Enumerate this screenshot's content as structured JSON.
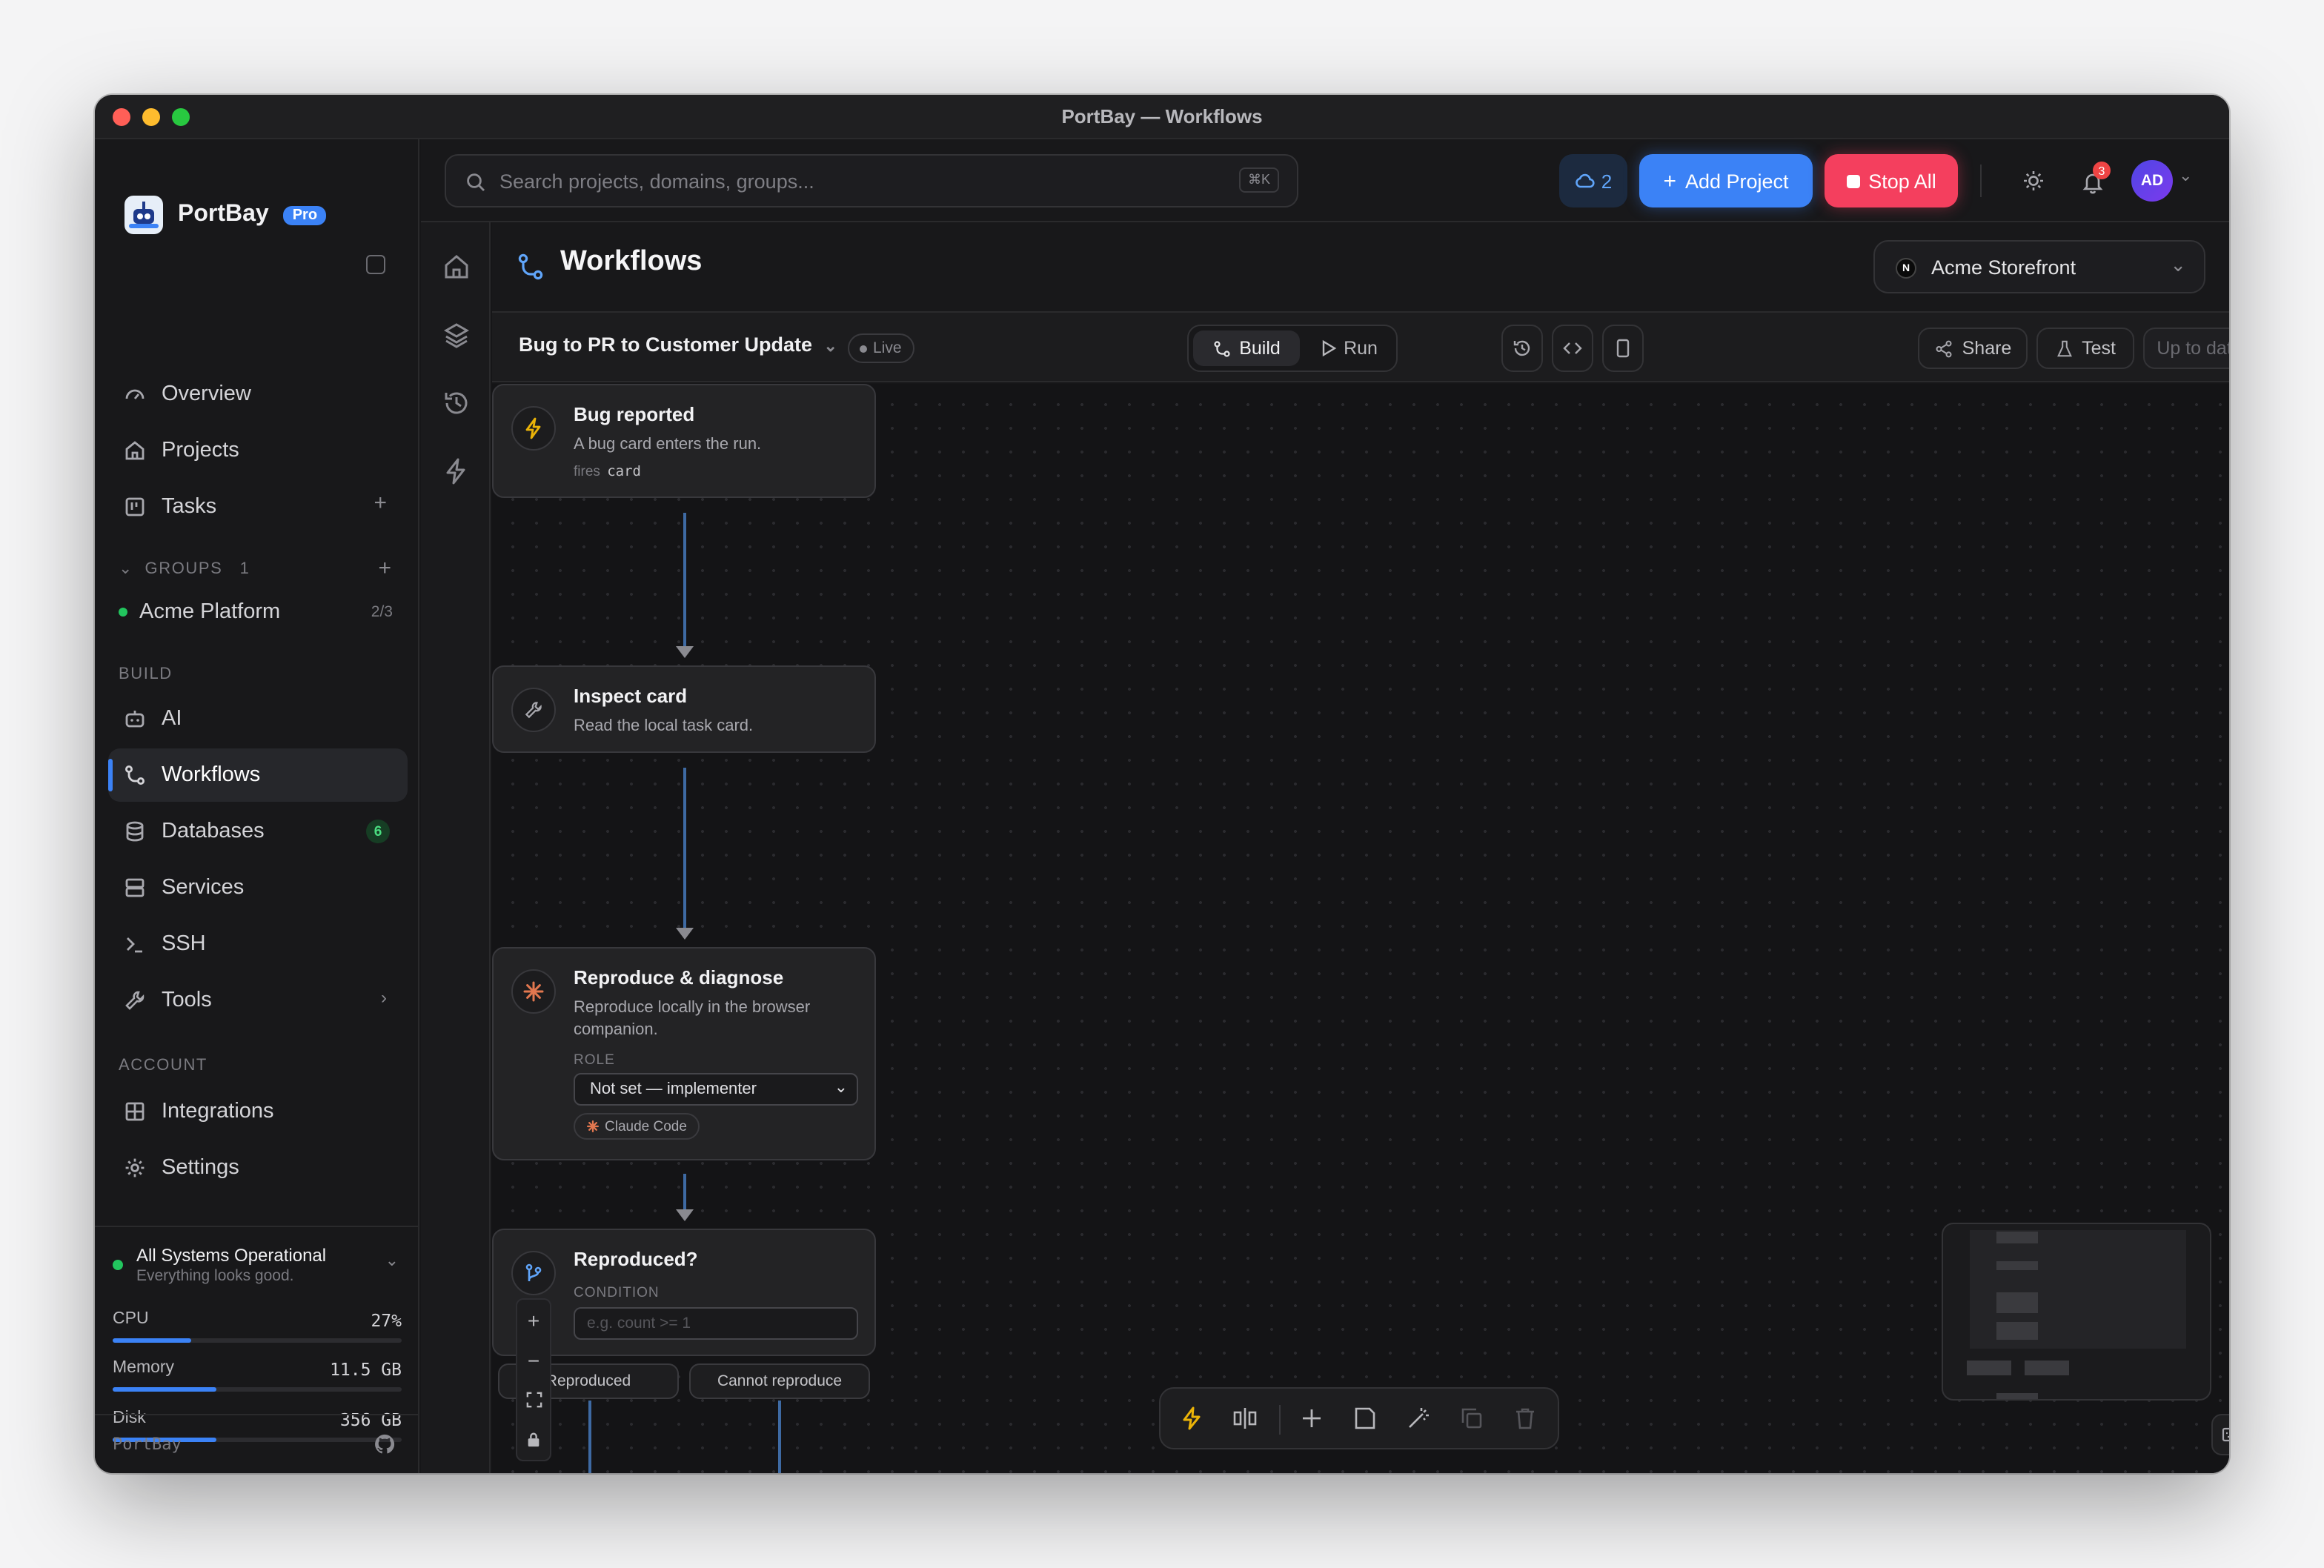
{
  "window": {
    "title": "PortBay — Workflows"
  },
  "sidebar": {
    "brand": "PortBay",
    "plan_badge": "Pro",
    "items_top": [
      {
        "label": "Overview",
        "icon": "gauge-icon"
      },
      {
        "label": "Projects",
        "icon": "home-icon"
      },
      {
        "label": "Tasks",
        "icon": "kanban-icon"
      }
    ],
    "groups_label": "GROUPS",
    "groups_count": "1",
    "group": {
      "name": "Acme Platform",
      "count": "2/3"
    },
    "build_label": "BUILD",
    "build_items": [
      {
        "label": "AI",
        "icon": "bot-icon"
      },
      {
        "label": "Workflows",
        "icon": "workflow-icon"
      },
      {
        "label": "Databases",
        "icon": "database-icon",
        "badge": "6"
      },
      {
        "label": "Services",
        "icon": "server-icon"
      },
      {
        "label": "SSH",
        "icon": "terminal-icon"
      },
      {
        "label": "Tools",
        "icon": "wrench-icon"
      }
    ],
    "account_label": "ACCOUNT",
    "account_items": [
      {
        "label": "Integrations",
        "icon": "grid-icon"
      },
      {
        "label": "Settings",
        "icon": "gear-icon"
      }
    ],
    "status": {
      "title": "All Systems Operational",
      "subtitle": "Everything looks good."
    },
    "metrics": [
      {
        "label": "CPU",
        "value": "27%",
        "fraction": 0.27
      },
      {
        "label": "Memory",
        "value": "11.5 GB",
        "fraction": 0.36
      },
      {
        "label": "Disk",
        "value": "356 GB",
        "fraction": 0.36
      }
    ],
    "footer": "PortBay"
  },
  "topbar": {
    "search_placeholder": "Search projects, domains, groups...",
    "search_shortcut": "⌘K",
    "cloud_count": "2",
    "add_project": "Add Project",
    "stop_all": "Stop All",
    "notification_count": "3",
    "avatar_initials": "AD"
  },
  "page": {
    "title": "Workflows",
    "project": "Acme Storefront",
    "project_initial": "N"
  },
  "toolbar": {
    "workflow_name": "Bug to PR to Customer Update",
    "live": "Live",
    "build": "Build",
    "run": "Run",
    "share": "Share",
    "test": "Test",
    "status": "Up to date"
  },
  "nodes": {
    "n1": {
      "title": "Bug reported",
      "desc": "A bug card enters the run.",
      "fires_label": "fires",
      "fires_value": "card"
    },
    "n2": {
      "title": "Inspect card",
      "desc": "Read the local task card."
    },
    "n3": {
      "title": "Reproduce & diagnose",
      "desc": "Reproduce locally in the browser companion.",
      "role_label": "ROLE",
      "role_value": "Not set — implementer",
      "agent": "Claude Code"
    },
    "n4": {
      "title": "Reproduced?",
      "condition_label": "CONDITION",
      "condition_placeholder": "e.g. count >= 1",
      "branch_yes": "Reproduced",
      "branch_no": "Cannot reproduce"
    }
  },
  "colors": {
    "accent": "#3b82f6",
    "danger": "#f43f5e",
    "success": "#22c55e",
    "trigger": "#eab308"
  }
}
